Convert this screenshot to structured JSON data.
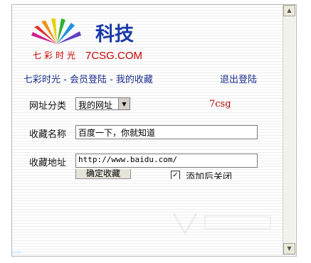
{
  "logo": {
    "title": "科技",
    "brand": "七彩时光",
    "site": "7CSG.COM"
  },
  "nav": {
    "breadcrumb": "七彩时光 - 会员登陆 - 我的收藏",
    "logout": "退出登陆"
  },
  "form": {
    "category_label": "网址分类",
    "category_value": "我的网址",
    "site_tag": "7csg",
    "name_label": "收藏名称",
    "name_value": "百度一下，你就知道",
    "url_label": "收藏地址",
    "url_value": "http://www.baidu.com/",
    "submit_label": "确定收藏",
    "close_after_add_checked": true,
    "close_after_add_label": "添加后关闭"
  },
  "icons": [
    "scroll-up-icon",
    "scroll-down-icon",
    "dropdown-arrow-icon",
    "checkbox-check-icon",
    "rainbow-rays-logo-icon"
  ],
  "colors": {
    "nav_text": "#1b2f8f",
    "tag_text": "#b00000",
    "logo_blue": "#1a3aa8",
    "logo_red": "#c80000"
  }
}
